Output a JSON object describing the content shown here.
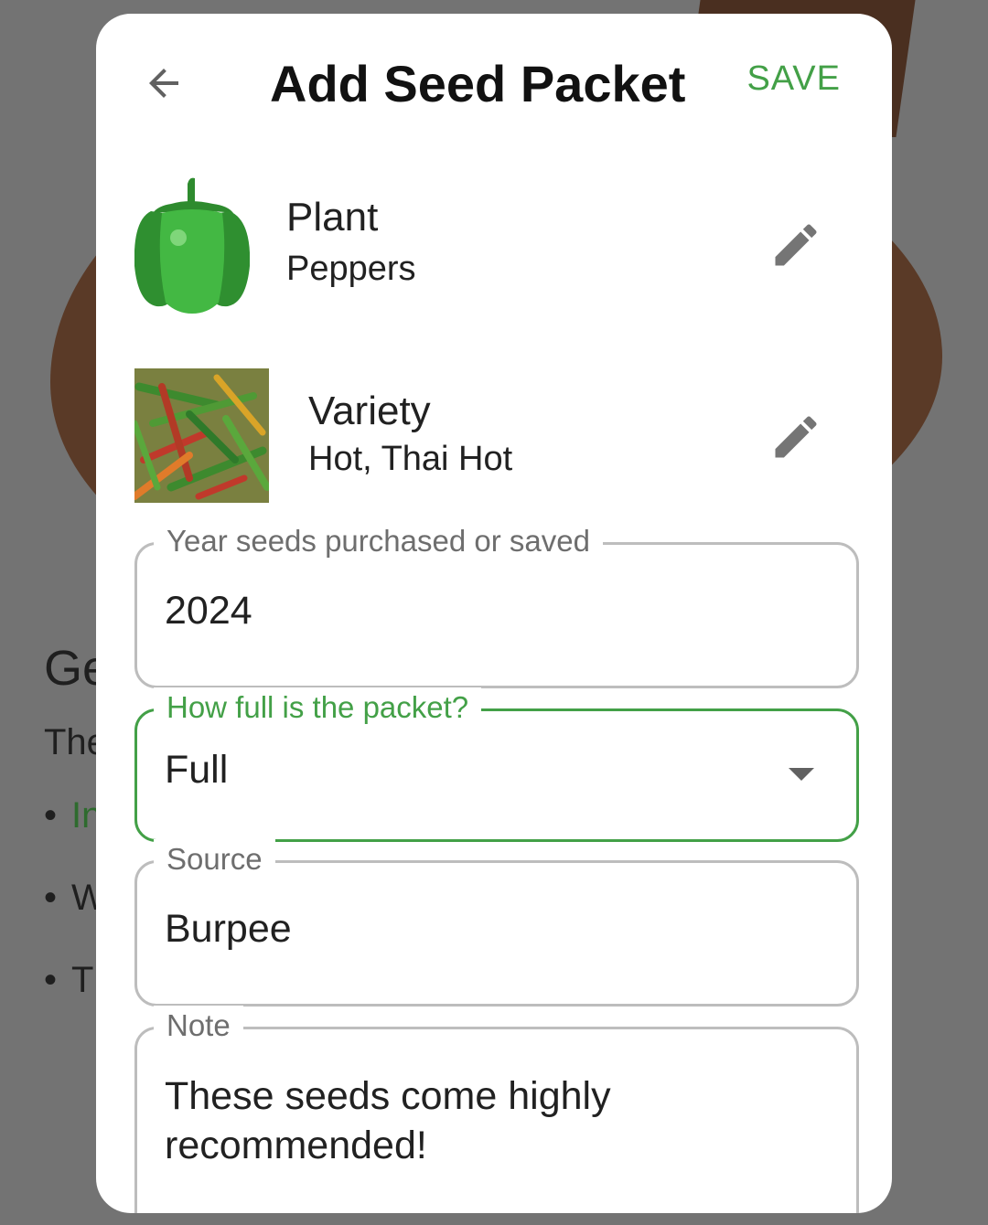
{
  "background": {
    "heading_fragment": "Ge",
    "text_fragment": "The",
    "bullets": [
      "In",
      "W",
      "T"
    ]
  },
  "dialog": {
    "title": "Add Seed Packet",
    "save_label": "SAVE",
    "plant": {
      "label": "Plant",
      "value": "Peppers"
    },
    "variety": {
      "label": "Variety",
      "value": "Hot, Thai Hot"
    },
    "year_field": {
      "label": "Year seeds purchased or saved",
      "value": "2024"
    },
    "fullness_field": {
      "label": "How full is the packet?",
      "value": "Full"
    },
    "source_field": {
      "label": "Source",
      "value": "Burpee"
    },
    "note_field": {
      "label": "Note",
      "value": "These seeds come highly recommended!"
    }
  },
  "colors": {
    "accent": "#43a047",
    "scrim": "#737373",
    "pepper": "#3fae3f"
  },
  "icons": [
    "back-arrow-icon",
    "pencil-icon",
    "dropdown-arrow-icon",
    "pepper-icon"
  ]
}
